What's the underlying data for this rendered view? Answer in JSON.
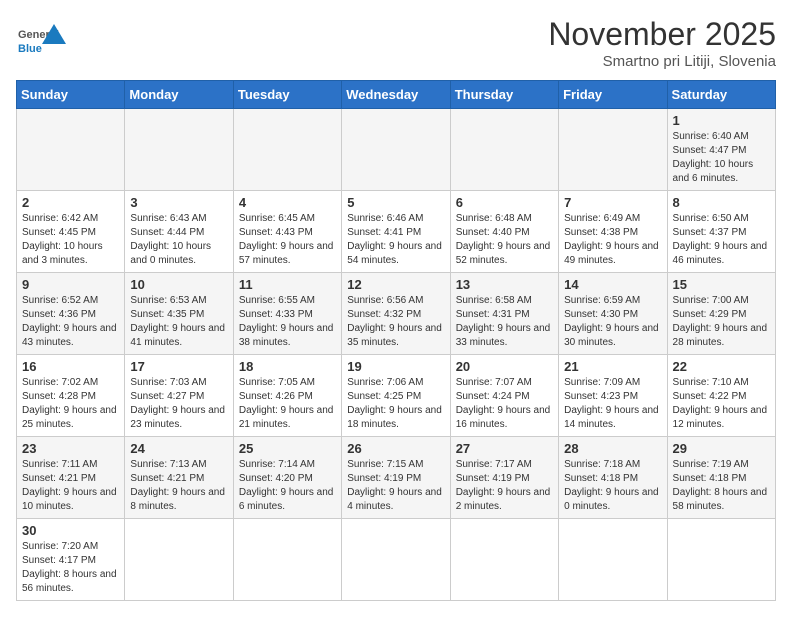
{
  "logo": {
    "text_general": "General",
    "text_blue": "Blue"
  },
  "header": {
    "month": "November 2025",
    "location": "Smartno pri Litiji, Slovenia"
  },
  "weekdays": [
    "Sunday",
    "Monday",
    "Tuesday",
    "Wednesday",
    "Thursday",
    "Friday",
    "Saturday"
  ],
  "weeks": [
    [
      {
        "day": "",
        "info": ""
      },
      {
        "day": "",
        "info": ""
      },
      {
        "day": "",
        "info": ""
      },
      {
        "day": "",
        "info": ""
      },
      {
        "day": "",
        "info": ""
      },
      {
        "day": "",
        "info": ""
      },
      {
        "day": "1",
        "info": "Sunrise: 6:40 AM\nSunset: 4:47 PM\nDaylight: 10 hours and 6 minutes."
      }
    ],
    [
      {
        "day": "2",
        "info": "Sunrise: 6:42 AM\nSunset: 4:45 PM\nDaylight: 10 hours and 3 minutes."
      },
      {
        "day": "3",
        "info": "Sunrise: 6:43 AM\nSunset: 4:44 PM\nDaylight: 10 hours and 0 minutes."
      },
      {
        "day": "4",
        "info": "Sunrise: 6:45 AM\nSunset: 4:43 PM\nDaylight: 9 hours and 57 minutes."
      },
      {
        "day": "5",
        "info": "Sunrise: 6:46 AM\nSunset: 4:41 PM\nDaylight: 9 hours and 54 minutes."
      },
      {
        "day": "6",
        "info": "Sunrise: 6:48 AM\nSunset: 4:40 PM\nDaylight: 9 hours and 52 minutes."
      },
      {
        "day": "7",
        "info": "Sunrise: 6:49 AM\nSunset: 4:38 PM\nDaylight: 9 hours and 49 minutes."
      },
      {
        "day": "8",
        "info": "Sunrise: 6:50 AM\nSunset: 4:37 PM\nDaylight: 9 hours and 46 minutes."
      }
    ],
    [
      {
        "day": "9",
        "info": "Sunrise: 6:52 AM\nSunset: 4:36 PM\nDaylight: 9 hours and 43 minutes."
      },
      {
        "day": "10",
        "info": "Sunrise: 6:53 AM\nSunset: 4:35 PM\nDaylight: 9 hours and 41 minutes."
      },
      {
        "day": "11",
        "info": "Sunrise: 6:55 AM\nSunset: 4:33 PM\nDaylight: 9 hours and 38 minutes."
      },
      {
        "day": "12",
        "info": "Sunrise: 6:56 AM\nSunset: 4:32 PM\nDaylight: 9 hours and 35 minutes."
      },
      {
        "day": "13",
        "info": "Sunrise: 6:58 AM\nSunset: 4:31 PM\nDaylight: 9 hours and 33 minutes."
      },
      {
        "day": "14",
        "info": "Sunrise: 6:59 AM\nSunset: 4:30 PM\nDaylight: 9 hours and 30 minutes."
      },
      {
        "day": "15",
        "info": "Sunrise: 7:00 AM\nSunset: 4:29 PM\nDaylight: 9 hours and 28 minutes."
      }
    ],
    [
      {
        "day": "16",
        "info": "Sunrise: 7:02 AM\nSunset: 4:28 PM\nDaylight: 9 hours and 25 minutes."
      },
      {
        "day": "17",
        "info": "Sunrise: 7:03 AM\nSunset: 4:27 PM\nDaylight: 9 hours and 23 minutes."
      },
      {
        "day": "18",
        "info": "Sunrise: 7:05 AM\nSunset: 4:26 PM\nDaylight: 9 hours and 21 minutes."
      },
      {
        "day": "19",
        "info": "Sunrise: 7:06 AM\nSunset: 4:25 PM\nDaylight: 9 hours and 18 minutes."
      },
      {
        "day": "20",
        "info": "Sunrise: 7:07 AM\nSunset: 4:24 PM\nDaylight: 9 hours and 16 minutes."
      },
      {
        "day": "21",
        "info": "Sunrise: 7:09 AM\nSunset: 4:23 PM\nDaylight: 9 hours and 14 minutes."
      },
      {
        "day": "22",
        "info": "Sunrise: 7:10 AM\nSunset: 4:22 PM\nDaylight: 9 hours and 12 minutes."
      }
    ],
    [
      {
        "day": "23",
        "info": "Sunrise: 7:11 AM\nSunset: 4:21 PM\nDaylight: 9 hours and 10 minutes."
      },
      {
        "day": "24",
        "info": "Sunrise: 7:13 AM\nSunset: 4:21 PM\nDaylight: 9 hours and 8 minutes."
      },
      {
        "day": "25",
        "info": "Sunrise: 7:14 AM\nSunset: 4:20 PM\nDaylight: 9 hours and 6 minutes."
      },
      {
        "day": "26",
        "info": "Sunrise: 7:15 AM\nSunset: 4:19 PM\nDaylight: 9 hours and 4 minutes."
      },
      {
        "day": "27",
        "info": "Sunrise: 7:17 AM\nSunset: 4:19 PM\nDaylight: 9 hours and 2 minutes."
      },
      {
        "day": "28",
        "info": "Sunrise: 7:18 AM\nSunset: 4:18 PM\nDaylight: 9 hours and 0 minutes."
      },
      {
        "day": "29",
        "info": "Sunrise: 7:19 AM\nSunset: 4:18 PM\nDaylight: 8 hours and 58 minutes."
      }
    ],
    [
      {
        "day": "30",
        "info": "Sunrise: 7:20 AM\nSunset: 4:17 PM\nDaylight: 8 hours and 56 minutes."
      },
      {
        "day": "",
        "info": ""
      },
      {
        "day": "",
        "info": ""
      },
      {
        "day": "",
        "info": ""
      },
      {
        "day": "",
        "info": ""
      },
      {
        "day": "",
        "info": ""
      },
      {
        "day": "",
        "info": ""
      }
    ]
  ]
}
